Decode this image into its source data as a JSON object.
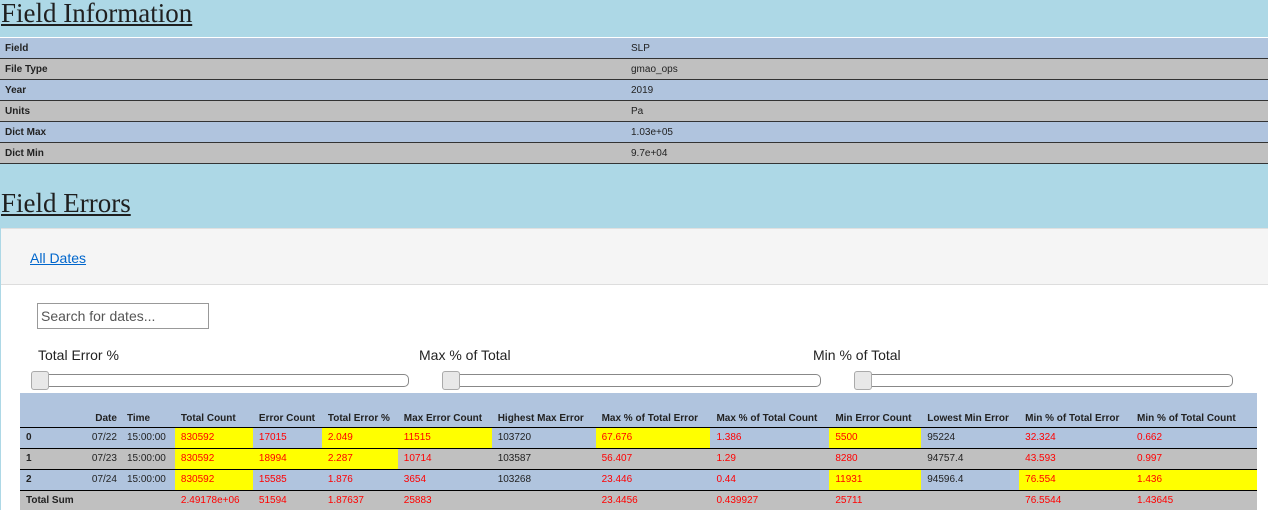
{
  "field_information": {
    "title": "Field Information",
    "rows": [
      {
        "label": "Field",
        "value": "SLP"
      },
      {
        "label": "File Type",
        "value": "gmao_ops"
      },
      {
        "label": "Year",
        "value": "2019"
      },
      {
        "label": "Units",
        "value": "Pa"
      },
      {
        "label": "Dict Max",
        "value": "1.03e+05"
      },
      {
        "label": "Dict Min",
        "value": "9.7e+04"
      }
    ]
  },
  "field_errors": {
    "title": "Field Errors",
    "tab_label": "All Dates",
    "search_placeholder": "Search for dates...",
    "filters": [
      {
        "label": "Total Error %",
        "value": 0
      },
      {
        "label": "Max % of Total",
        "value": 0
      },
      {
        "label": "Min % of Total",
        "value": 0
      }
    ],
    "columns": [
      "",
      "Date",
      "Time",
      "Total Count",
      "Error Count",
      "Total Error %",
      "Max Error Count",
      "Highest Max Error",
      "Max % of Total Error",
      "Max % of Total Count",
      "Min Error Count",
      "Lowest Min Error",
      "Min % of Total Error",
      "Min % of Total Count"
    ],
    "rows": [
      [
        "0",
        "07/22",
        "15:00:00",
        "830592",
        "17015",
        "2.049",
        "11515",
        "103720",
        "67.676",
        "1.386",
        "5500",
        "95224",
        "32.324",
        "0.662"
      ],
      [
        "1",
        "07/23",
        "15:00:00",
        "830592",
        "18994",
        "2.287",
        "10714",
        "103587",
        "56.407",
        "1.29",
        "8280",
        "94757.4",
        "43.593",
        "0.997"
      ],
      [
        "2",
        "07/24",
        "15:00:00",
        "830592",
        "15585",
        "1.876",
        "3654",
        "103268",
        "23.446",
        "0.44",
        "11931",
        "94596.4",
        "76.554",
        "1.436"
      ]
    ],
    "sum_row": [
      "Total Sum",
      "",
      "",
      "2.49178e+06",
      "51594",
      "1.87637",
      "25883",
      "",
      "23.4456",
      "0.439927",
      "25711",
      "",
      "76.5544",
      "1.43645"
    ],
    "highlight_color": "#ffff00",
    "error_text_color": "#ff0000"
  }
}
